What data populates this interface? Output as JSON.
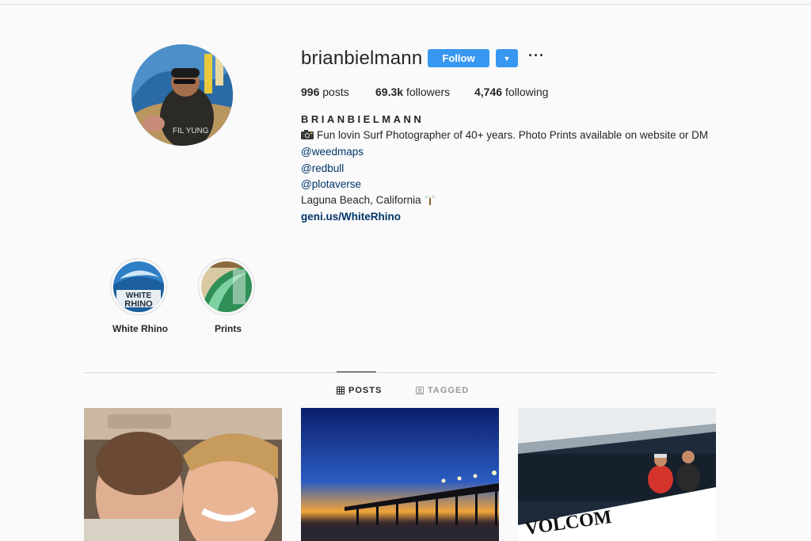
{
  "profile": {
    "username": "brianbielmann",
    "follow_label": "Follow",
    "dropdown_icon": "▼",
    "more_icon": "···",
    "stats": {
      "posts_count": "996",
      "posts_label": "posts",
      "followers_count": "69.3k",
      "followers_label": "followers",
      "following_count": "4,746",
      "following_label": "following"
    },
    "full_name": "BRIANBIELMANN",
    "bio": {
      "line1_icon": "camera-emoji",
      "line1": "Fun lovin Surf Photographer of 40+ years. Photo Prints available on website or DM",
      "mention1": "@weedmaps",
      "mention2": "@redbull",
      "mention3": "@plotaverse",
      "location": "Laguna Beach, California",
      "location_icon": "palm-tree-emoji",
      "website": "geni.us/WhiteRhino"
    }
  },
  "highlights": [
    {
      "label": "White Rhino"
    },
    {
      "label": "Prints"
    }
  ],
  "tabs": [
    {
      "label": "POSTS",
      "icon": "grid-icon",
      "active": true
    },
    {
      "label": "TAGGED",
      "icon": "tag-icon",
      "active": false
    }
  ],
  "colors": {
    "accent": "#3897f0",
    "link": "#003569",
    "background": "#fafafa"
  }
}
